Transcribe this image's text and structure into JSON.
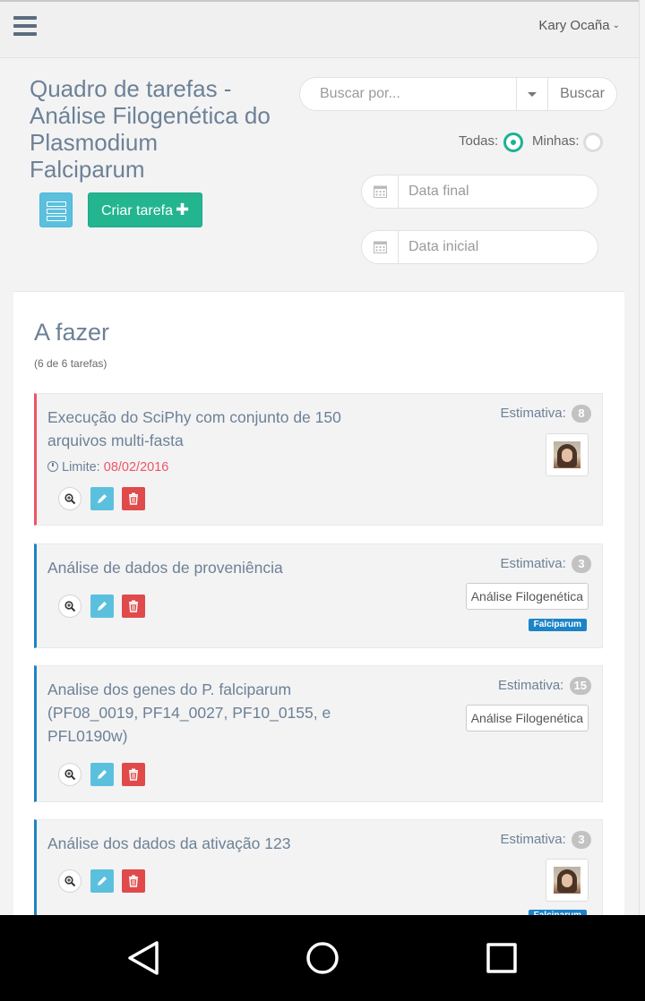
{
  "topbar": {
    "user_name": "Kary Ocaña"
  },
  "header": {
    "title": "Quadro de tarefas - Análise Filogenética do Plasmodium Falciparum",
    "create_task_label": "Criar tarefa",
    "create_task_icon": "plus-icon"
  },
  "search": {
    "placeholder": "Buscar por...",
    "button_label": "Buscar"
  },
  "filters": {
    "all_label": "Todas:",
    "all_selected": true,
    "mine_label": "Minhas:",
    "mine_selected": false,
    "end_date_placeholder": "Data final",
    "start_date_placeholder": "Data inicial"
  },
  "column": {
    "title": "A fazer",
    "count": "(6 de 6 tarefas)"
  },
  "tasks": [
    {
      "title": "Execução do SciPhy com conjunto de 150 arquivos multi-fasta",
      "deadline_label": "Limite:",
      "deadline_date": "08/02/2016",
      "estimate_label": "Estimativa:",
      "estimate": "8",
      "accent": "#ed5565"
    },
    {
      "title": "Análise de dados de proveniência",
      "estimate_label": "Estimativa:",
      "estimate": "3",
      "project": "Análise Filogenética",
      "label": "Falciparum",
      "accent": "#1c84c6"
    },
    {
      "title": "Analise dos genes do P. falciparum (PF08_0019, PF14_0027, PF10_0155, e PFL0190w)",
      "estimate_label": "Estimativa:",
      "estimate": "15",
      "project": "Análise Filogenética",
      "accent": "#1c84c6"
    },
    {
      "title": "Análise dos dados da ativação 123",
      "estimate_label": "Estimativa:",
      "estimate": "3",
      "label": "Falciparum",
      "accent": "#1c84c6"
    }
  ],
  "colors": {
    "primary": "#1ab394",
    "create_button": "#23b590",
    "info": "#5bc0de",
    "danger": "#e04a4a",
    "label_blue": "#1c84c6",
    "title_slate": "#6d8196"
  },
  "icons": [
    "menu-icon",
    "chevron-down-icon",
    "list-view-icon",
    "calendar-icon",
    "clock-icon",
    "zoom-icon",
    "pencil-icon",
    "trash-icon",
    "back-icon",
    "home-icon",
    "recents-icon"
  ]
}
